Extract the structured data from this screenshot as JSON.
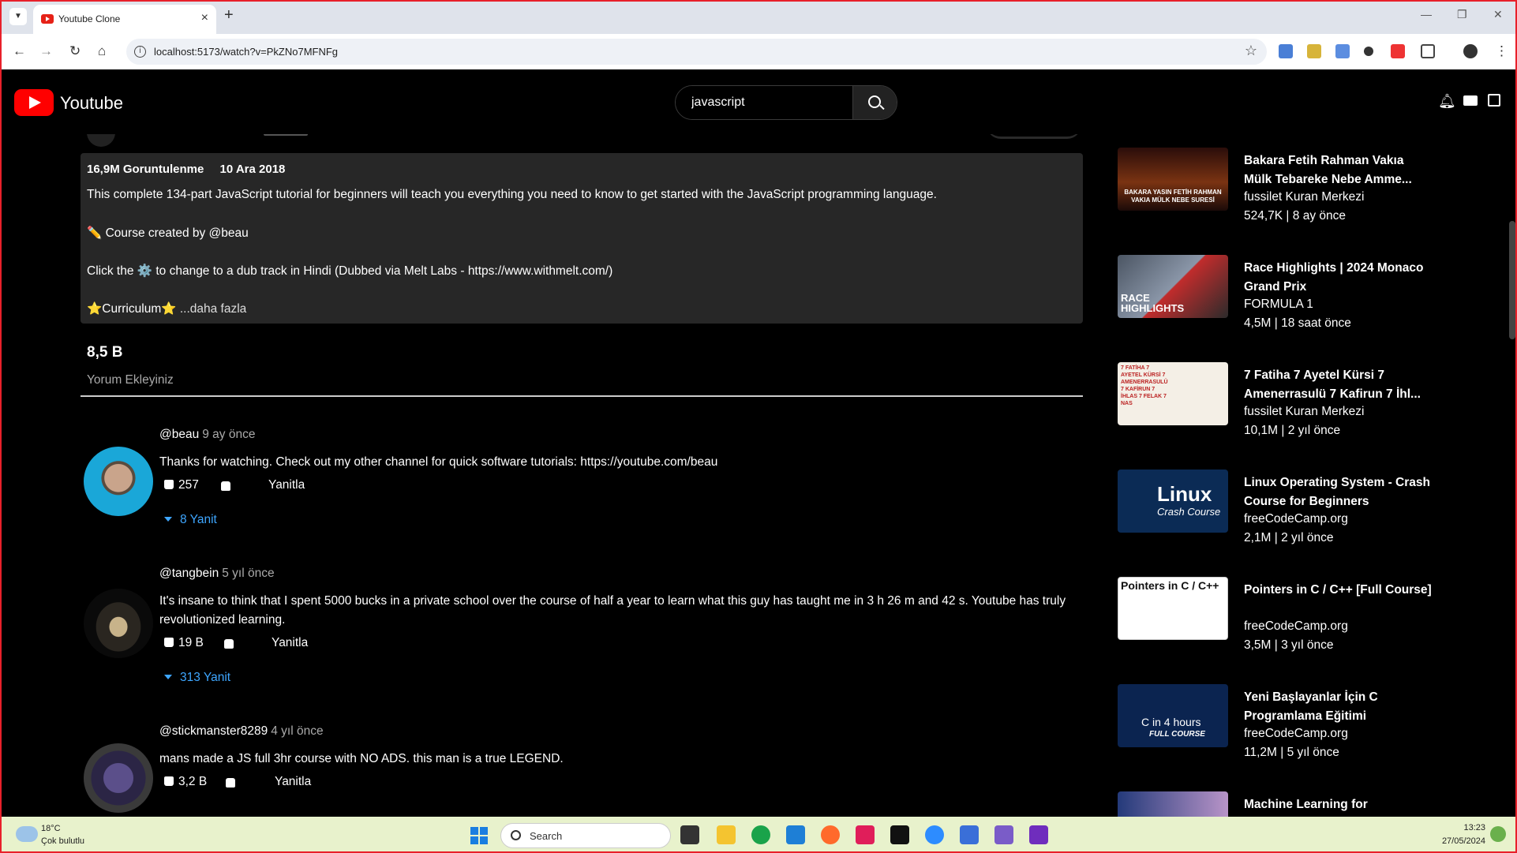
{
  "browser": {
    "tab_title": "Youtube Clone",
    "url": "localhost:5173/watch?v=PkZNo7MFNFg",
    "new_tab": "+",
    "close_tab": "×"
  },
  "header": {
    "brand": "Youtube",
    "search_value": "javascript"
  },
  "description": {
    "views": "16,9M Goruntulenme",
    "date": "10 Ara 2018",
    "line1": "This complete 134-part JavaScript tutorial for beginners will teach you everything you need to know to get started with the JavaScript programming language.",
    "line2": "✏️ Course created by @beau",
    "line3": "Click the ⚙️ to change to a dub track in Hindi (Dubbed via Melt Labs - https://www.withmelt.com/)",
    "line4_text": "⭐️Curriculum⭐️",
    "line4_more": "...daha fazla"
  },
  "comments_section": {
    "count": "8,5 B",
    "add_placeholder": "Yorum Ekleyiniz"
  },
  "comments": [
    {
      "author": "@beau",
      "time": "9 ay önce",
      "text": "Thanks for watching. Check out my other channel for quick software tutorials: https://youtube.com/beau",
      "likes": "257",
      "reply_label": "Yanitla",
      "replies": "8 Yanit"
    },
    {
      "author": "@tangbein",
      "time": "5 yıl önce",
      "text": "It's insane to think that I spent 5000 bucks in a private school over the course of half a year to learn what this guy has taught me in 3 h 26 m and 42 s. Youtube has truly revolutionized learning.",
      "likes": "19 B",
      "reply_label": "Yanitla",
      "replies": "313 Yanit"
    },
    {
      "author": "@stickmanster8289",
      "time": "4 yıl önce",
      "text": "mans made a JS full 3hr course with NO ADS. this man is a true LEGEND.",
      "likes": "3,2 B",
      "reply_label": "Yanitla"
    }
  ],
  "recommendations": [
    {
      "title": "Bakara Fetih Rahman Vakıa Mülk Tebareke Nebe Amme...",
      "channel": "fussilet Kuran Merkezi",
      "meta": "524,7K | 8 ay önce",
      "thumb_text": "BAKARA YASIN FETİH RAHMAN VAKIA MÜLK NEBE SURESİ"
    },
    {
      "title": "Race Highlights | 2024 Monaco Grand Prix",
      "channel": "FORMULA 1",
      "meta": "4,5M | 18 saat önce",
      "thumb_text": "RACE HIGHLIGHTS"
    },
    {
      "title": "7 Fatiha 7 Ayetel Kürsi 7 Amenerrasulü 7 Kafirun 7 İhl...",
      "channel": "fussilet Kuran Merkezi",
      "meta": "10,1M | 2 yıl önce",
      "thumb_text": "7 FATİHA 7 AYETEL KÜRSİ 7 AMENERRASULÜ 7 KAFİRUN 7 İHLAS 7 FELAK 7 NAS"
    },
    {
      "title": "Linux Operating System - Crash Course for Beginners",
      "channel": "freeCodeCamp.org",
      "meta": "2,1M | 2 yıl önce",
      "thumb_text": "Linux",
      "thumb_sub": "Crash Course"
    },
    {
      "title": "Pointers in C / C++ [Full Course]",
      "channel": "freeCodeCamp.org",
      "meta": "3,5M | 3 yıl önce",
      "thumb_text": "Pointers in C / C++"
    },
    {
      "title": "Yeni Başlayanlar İçin C Programlama Eğitimi",
      "channel": "freeCodeCamp.org",
      "meta": "11,2M | 5 yıl önce",
      "thumb_text": "C in 4 hours",
      "thumb_sub": "FULL COURSE"
    },
    {
      "title": "Machine Learning for",
      "channel": "",
      "meta": ""
    }
  ],
  "taskbar": {
    "temperature": "18°C",
    "weather": "Çok bulutlu",
    "search_label": "Search",
    "time": "13:23",
    "date": "27/05/2024"
  },
  "colors": {
    "accent_red": "#ff0000",
    "link_blue": "#3ea6ff",
    "desc_bg": "#272727",
    "frame_red": "#e8202a"
  }
}
